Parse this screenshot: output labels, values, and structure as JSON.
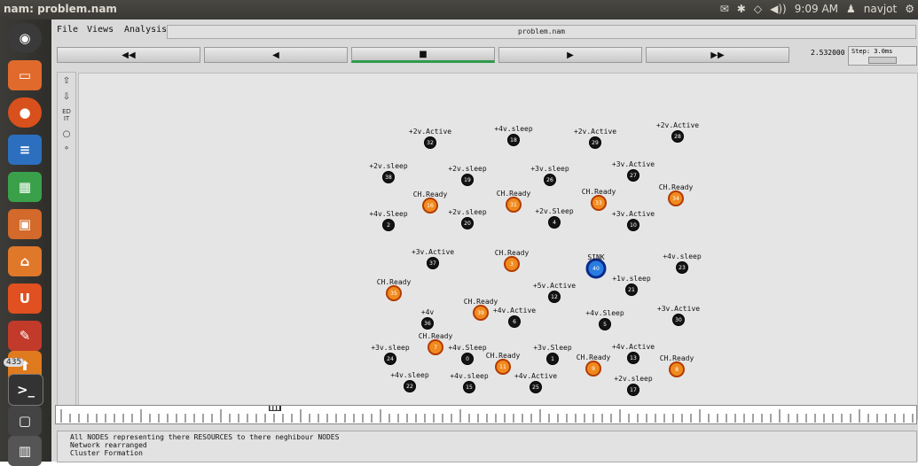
{
  "topbar": {
    "app_title": "nam: problem.nam",
    "clock": "9:09 AM",
    "user": "navjot"
  },
  "launcher": {
    "badge_count": "435"
  },
  "window": {
    "menus": [
      "File",
      "Views",
      "Analysis"
    ],
    "filename": "problem.nam",
    "controls": [
      "◀◀",
      "◀",
      "■",
      "▶",
      "▶▶"
    ],
    "time_value": "2.532000",
    "step_label": "Step: 3.0ms"
  },
  "network": {
    "nodes": [
      {
        "id": "32",
        "label": "+2v.Active",
        "type": "normal"
      },
      {
        "id": "18",
        "label": "+4v.sleep",
        "type": "normal"
      },
      {
        "id": "29",
        "label": "+2v.Active",
        "type": "normal"
      },
      {
        "id": "28",
        "label": "+2v.Active",
        "type": "normal"
      },
      {
        "id": "38",
        "label": "+2v.sleep",
        "type": "normal"
      },
      {
        "id": "19",
        "label": "+2v.sleep",
        "type": "normal"
      },
      {
        "id": "26",
        "label": "+3v.sleep",
        "type": "normal"
      },
      {
        "id": "27",
        "label": "+3v.Active",
        "type": "normal"
      },
      {
        "id": "16",
        "label": "CH.Ready",
        "type": "ch"
      },
      {
        "id": "31",
        "label": "CH.Ready",
        "type": "ch"
      },
      {
        "id": "33",
        "label": "CH.Ready",
        "type": "ch"
      },
      {
        "id": "34",
        "label": "CH.Ready",
        "type": "ch"
      },
      {
        "id": "2",
        "label": "+4v.Sleep",
        "type": "normal"
      },
      {
        "id": "20",
        "label": "+2v.sleep",
        "type": "normal"
      },
      {
        "id": "4",
        "label": "+2v.Sleep",
        "type": "normal"
      },
      {
        "id": "10",
        "label": "+3v.Active",
        "type": "normal"
      },
      {
        "id": "37",
        "label": "+3v.Active",
        "type": "normal"
      },
      {
        "id": "3",
        "label": "CH.Ready",
        "type": "ch"
      },
      {
        "id": "40",
        "label": "SINK",
        "type": "sink"
      },
      {
        "id": "23",
        "label": "+4v.sleep",
        "type": "normal"
      },
      {
        "id": "35",
        "label": "CH.Ready",
        "type": "ch"
      },
      {
        "id": "21",
        "label": "+1v.sleep",
        "type": "normal"
      },
      {
        "id": "12",
        "label": "+5v.Active",
        "type": "normal"
      },
      {
        "id": "39",
        "label": "CH.Ready",
        "type": "ch"
      },
      {
        "id": "6",
        "label": "+4v.Active",
        "type": "normal"
      },
      {
        "id": "36",
        "label": "+4v",
        "type": "normal"
      },
      {
        "id": "5",
        "label": "+4v.Sleep",
        "type": "normal"
      },
      {
        "id": "30",
        "label": "+3v.Active",
        "type": "normal"
      },
      {
        "id": "7",
        "label": "CH.Ready",
        "type": "ch"
      },
      {
        "id": "24",
        "label": "+3v.sleep",
        "type": "normal"
      },
      {
        "id": "0",
        "label": "+4v.Sleep",
        "type": "normal"
      },
      {
        "id": "11",
        "label": "CH.Ready",
        "type": "ch"
      },
      {
        "id": "1",
        "label": "+3v.Sleep",
        "type": "normal"
      },
      {
        "id": "9",
        "label": "CH.Ready",
        "type": "ch"
      },
      {
        "id": "13",
        "label": "+4v.Active",
        "type": "normal"
      },
      {
        "id": "8",
        "label": "CH.Ready",
        "type": "ch"
      },
      {
        "id": "22",
        "label": "+4v.sleep",
        "type": "normal"
      },
      {
        "id": "15",
        "label": "+4v.sleep",
        "type": "normal"
      },
      {
        "id": "25",
        "label": "+4v.Active",
        "type": "normal"
      },
      {
        "id": "17",
        "label": "+2v.sleep",
        "type": "normal"
      }
    ],
    "colors": {
      "normal": "#141414",
      "ch": "#f08a1e",
      "ch_ring": "#b33a00",
      "sink": "#2a7de0",
      "sink_ring": "#0b2a8c"
    }
  },
  "log": {
    "lines": [
      "All NODES representing there RESOURCES to there neghibour NODES",
      "Network rearranged",
      "Cluster Formation"
    ]
  }
}
